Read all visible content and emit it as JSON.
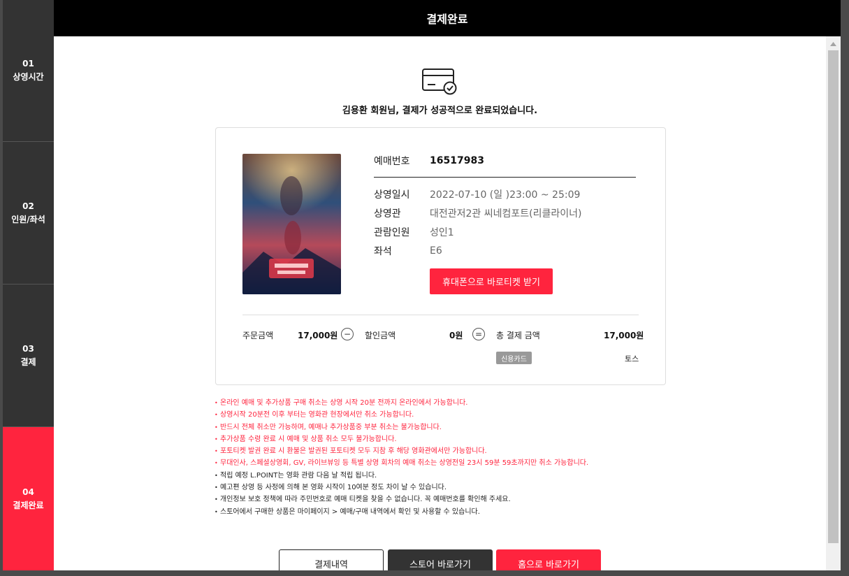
{
  "header": {
    "title": "결제완료"
  },
  "steps": [
    {
      "num": "01",
      "label": "상영시간"
    },
    {
      "num": "02",
      "label": "인원/좌석"
    },
    {
      "num": "03",
      "label": "결제"
    },
    {
      "num": "04",
      "label": "결제완료",
      "active": true
    }
  ],
  "message": "김용환 회원님, 결제가 성공적으로 완료되었습니다.",
  "booking": {
    "number_label": "예매번호",
    "number": "16517983",
    "datetime_label": "상영일시",
    "datetime": "2022-07-10 (일 )23:00 ~ 25:09",
    "theater_label": "상영관",
    "theater": "대전관저2관 씨네컴포트(리클라이너)",
    "people_label": "관람인원",
    "people": "성인1",
    "seat_label": "좌석",
    "seat": "E6",
    "mobile_ticket_button": "휴대폰으로 바로티켓 받기"
  },
  "payment": {
    "order_label": "주문금액",
    "order_amount": "17,000원",
    "minus_symbol": "−",
    "discount_label": "할인금액",
    "discount_amount": "0원",
    "equals_symbol": "=",
    "total_label": "총 결제 금액",
    "total_amount": "17,000원",
    "method_badge": "신용카드",
    "method_provider": "토스"
  },
  "notices": [
    {
      "text": "온라인 예매 및 추가상품 구매 취소는 상영 시작 20분 전까지 온라인에서 가능합니다.",
      "color": "red"
    },
    {
      "text": "상영시작 20분전 이후 부터는 영화관 현장에서만 취소 가능합니다.",
      "color": "red"
    },
    {
      "text": "반드시 전체 취소만 가능하며, 예매나 추가상품중 부분 취소는 불가능합니다.",
      "color": "red"
    },
    {
      "text": "추가상품 수령 완료 시 예매 및 상품 취소 모두 불가능합니다.",
      "color": "red"
    },
    {
      "text": "포토티켓 발권 완료 시 환불은 발권된 포토티켓 모두 지참 후 해당 영화관에서만 가능합니다.",
      "color": "red"
    },
    {
      "text": "무대인사, 스페셜상영회, GV, 라이브뷰잉 등 특별 상영 회차의 예매 취소는 상영전일 23시 59분 59초까지만 취소 가능합니다.",
      "color": "red"
    },
    {
      "text": "적립 예정 L.POINT는 영화 관람 다음 날 적립 됩니다.",
      "color": "black"
    },
    {
      "text": "예고편 상영 등 사정에 의해 본 영화 시작이 10여분 정도 차이 날 수 있습니다.",
      "color": "black"
    },
    {
      "text": "개인정보 보호 정책에 따라 주민번호로 예매 티켓을 찾을 수 없습니다. 꼭 예매번호를 확인해 주세요.",
      "color": "black"
    },
    {
      "text": "스토어에서 구매한 상품은 마이페이지 > 예매/구매 내역에서 확인 및 사용할 수 있습니다.",
      "color": "black"
    }
  ],
  "buttons": {
    "history": "결제내역",
    "store": "스토어 바로가기",
    "home": "홈으로 바로가기"
  },
  "colors": {
    "accent": "#ff243e",
    "sidebar": "#333333",
    "header": "#000000"
  },
  "icons": {
    "card": "credit-card-check-icon",
    "scroll_up": "scroll-up-arrow-icon"
  }
}
